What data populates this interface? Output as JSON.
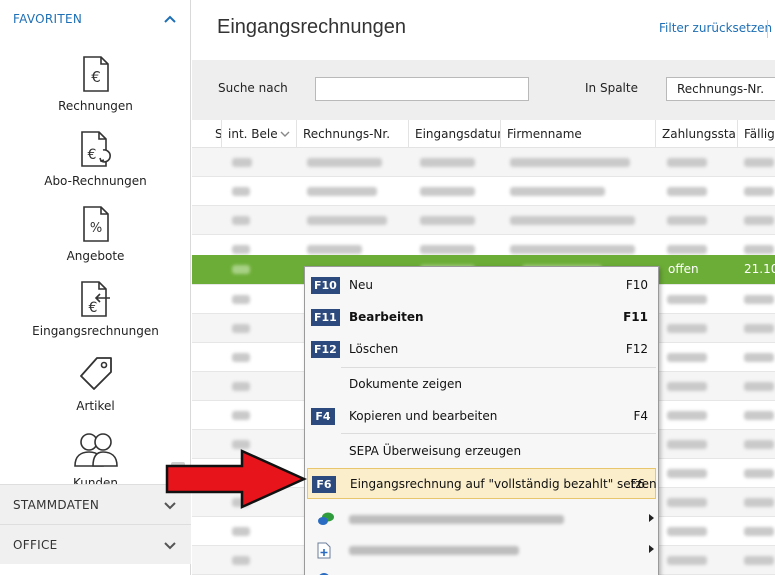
{
  "sidebar": {
    "favorites_label": "FAVORITEN",
    "items": [
      {
        "label": "Rechnungen",
        "icon": "invoice-euro-icon"
      },
      {
        "label": "Abo-Rechnungen",
        "icon": "subscription-invoice-icon"
      },
      {
        "label": "Angebote",
        "icon": "quote-percent-icon"
      },
      {
        "label": "Eingangsrechnungen",
        "icon": "incoming-invoice-icon"
      },
      {
        "label": "Artikel",
        "icon": "price-tag-icon"
      },
      {
        "label": "Kunden",
        "icon": "customers-icon"
      }
    ],
    "sections": [
      {
        "label": "STAMMDATEN"
      },
      {
        "label": "OFFICE"
      }
    ]
  },
  "main": {
    "title": "Eingangsrechnungen",
    "filter_reset": "Filter zurücksetzen",
    "search": {
      "label": "Suche nach",
      "value": "",
      "column_label": "In Spalte",
      "column_value": "Rechnungs-Nr."
    },
    "table": {
      "columns": [
        "S",
        "int. Bele",
        "Rechnungs-Nr.",
        "Eingangsdatun",
        "Firmenname",
        "Zahlungssta",
        "Fällig"
      ],
      "selected_row": {
        "status": "offen",
        "due": "21.10."
      }
    }
  },
  "context_menu": {
    "items": [
      {
        "key": "F10",
        "label": "Neu",
        "shortcut": "F10"
      },
      {
        "key": "F11",
        "label": "Bearbeiten",
        "shortcut": "F11"
      },
      {
        "key": "F12",
        "label": "Löschen",
        "shortcut": "F12"
      },
      {
        "label": "Dokumente zeigen"
      },
      {
        "key": "F4",
        "label": "Kopieren und bearbeiten",
        "shortcut": "F4"
      },
      {
        "label": "SEPA Überweisung erzeugen"
      },
      {
        "key": "F6",
        "label": "Eingangsrechnung auf \"vollständig bezahlt\" setzen",
        "shortcut": "F6"
      }
    ]
  },
  "colors": {
    "accent": "#1e6fb5",
    "selected_row": "#6cad37",
    "key_badge": "#2c4a7e",
    "highlight": "#fbeecb",
    "arrow": "#e8141c"
  }
}
